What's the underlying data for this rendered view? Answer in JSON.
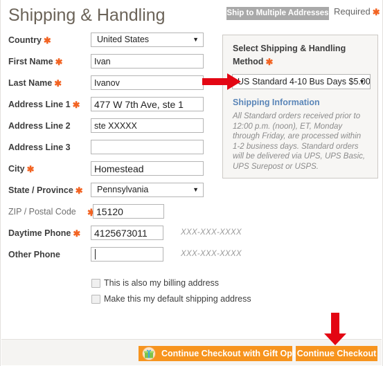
{
  "header": {
    "title": "Shipping & Handling",
    "ship_multiple_label": "Ship to Multiple Addresses",
    "required_label": "Required",
    "required_star": "✱"
  },
  "colors": {
    "accent_orange": "#f26322",
    "button_orange": "#f7941e",
    "title_gray": "#6b6358",
    "link_blue": "#5b86b8",
    "arrow_red": "#e30613",
    "panel_bg": "#f7f6f4",
    "gray_button": "#a9a9a9"
  },
  "form": {
    "fields": [
      {
        "name": "country",
        "label": "Country",
        "required": true,
        "type": "select",
        "value": "United States",
        "options": [
          "United States"
        ]
      },
      {
        "name": "first-name",
        "label": "First Name",
        "required": true,
        "type": "text",
        "value": "Ivan",
        "placeholder": ""
      },
      {
        "name": "last-name",
        "label": "Last Name",
        "required": true,
        "type": "text",
        "value": "Ivanov",
        "placeholder": ""
      },
      {
        "name": "address-line-1",
        "label": "Address Line 1",
        "required": true,
        "type": "text",
        "value": "477 W 7th Ave, ste 1",
        "placeholder": ""
      },
      {
        "name": "address-line-2",
        "label": "Address Line 2",
        "required": false,
        "type": "text",
        "value": "ste XXXXX",
        "placeholder": ""
      },
      {
        "name": "address-line-3",
        "label": "Address Line 3",
        "required": false,
        "type": "text",
        "value": "",
        "placeholder": ""
      },
      {
        "name": "city",
        "label": "City",
        "required": true,
        "type": "text",
        "value": "Homestead",
        "placeholder": ""
      },
      {
        "name": "state-province",
        "label": "State / Province",
        "required": true,
        "type": "select",
        "value": "Pennsylvania",
        "options": [
          "Pennsylvania"
        ]
      },
      {
        "name": "zip-postal-code",
        "label": "ZIP / Postal Code",
        "required": true,
        "type": "text",
        "value": "15120",
        "placeholder": ""
      },
      {
        "name": "daytime-phone",
        "label": "Daytime Phone",
        "required": true,
        "type": "text",
        "value": "4125673011",
        "placeholder": "",
        "hint": "XXX-XXX-XXXX"
      },
      {
        "name": "other-phone",
        "label": "Other Phone",
        "required": false,
        "type": "text",
        "value": "",
        "placeholder": "",
        "hint": "XXX-XXX-XXXX"
      }
    ],
    "checkboxes": [
      {
        "name": "billing-address",
        "label": "This is also my billing address",
        "checked": false
      },
      {
        "name": "default-shipping",
        "label": "Make this my default shipping address",
        "checked": false
      }
    ]
  },
  "shipping_panel": {
    "title": "Select Shipping & Handling Method",
    "required_star": "✱",
    "method_value": "US Standard 4-10 Bus Days $5.00",
    "method_options": [
      "US Standard 4-10 Bus Days $5.00"
    ],
    "info_title": "Shipping Information",
    "info_body": "All Standard orders received prior to 12:00 p.m. (noon), ET, Monday through Friday, are processed within 1-2 business days. Standard orders will be delivered via UPS, UPS Basic, UPS Surepost or USPS."
  },
  "footer": {
    "gift_label": "Continue Checkout with Gift Options",
    "continue_label": "Continue Checkout"
  },
  "annotations": {
    "arrow_right_name": "arrow-pointing-to-shipping-method",
    "arrow_down_name": "arrow-pointing-to-continue-checkout"
  }
}
